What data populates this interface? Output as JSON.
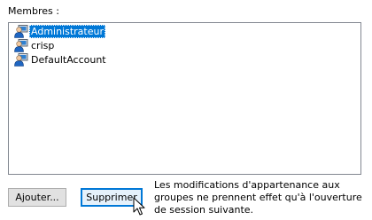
{
  "members": {
    "label": "Membres :",
    "items": [
      {
        "label": "Administrateur",
        "icon": "user-icon",
        "selected": true
      },
      {
        "label": "crisp",
        "icon": "user-icon",
        "selected": false
      },
      {
        "label": "DefaultAccount",
        "icon": "user-icon",
        "selected": false
      }
    ]
  },
  "buttons": {
    "add_label": "Ajouter...",
    "remove_label": "Supprimer"
  },
  "note": "Les modifications d'appartenance aux groupes ne prennent effet qu'à l'ouverture de session suivante.",
  "colors": {
    "selection": "#0078d7",
    "list_border": "#828790",
    "button_face": "#e1e1e1",
    "button_focus_border": "#0078d7"
  },
  "cursor_icon": "arrow-cursor-icon"
}
